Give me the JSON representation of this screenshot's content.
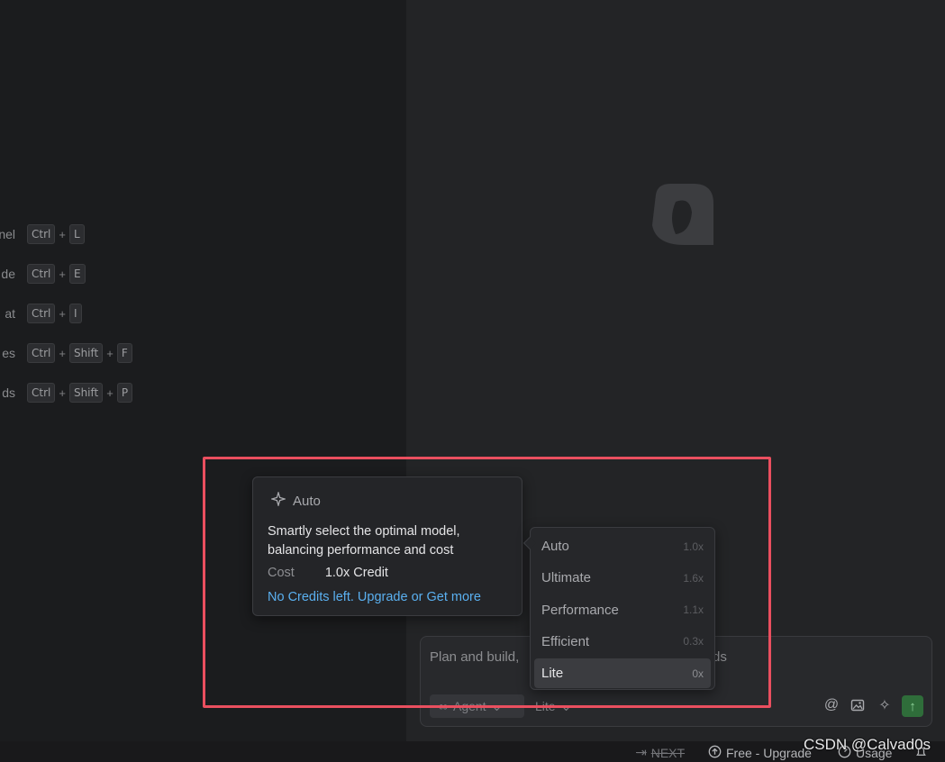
{
  "shortcuts": [
    {
      "label": "nel",
      "keys": [
        "Ctrl",
        "L"
      ]
    },
    {
      "label": "de",
      "keys": [
        "Ctrl",
        "E"
      ]
    },
    {
      "label": "at",
      "keys": [
        "Ctrl",
        "I"
      ]
    },
    {
      "label": "es",
      "keys": [
        "Ctrl",
        "Shift",
        "F"
      ]
    },
    {
      "label": "ds",
      "keys": [
        "Ctrl",
        "Shift",
        "P"
      ]
    }
  ],
  "shortcut_plus": "+",
  "tooltip": {
    "icon": "sparkle-icon",
    "title": "Auto",
    "description": "Smartly select the optimal model, balancing performance and cost",
    "cost_label": "Cost",
    "cost_value": "1.0x Credit",
    "link": "No Credits left. Upgrade or Get more"
  },
  "model_menu": {
    "items": [
      {
        "label": "Auto",
        "multiplier": "1.0x",
        "selected": false
      },
      {
        "label": "Ultimate",
        "multiplier": "1.6x",
        "selected": false
      },
      {
        "label": "Performance",
        "multiplier": "1.1x",
        "selected": false
      },
      {
        "label": "Efficient",
        "multiplier": "0.3x",
        "selected": false
      },
      {
        "label": "Lite",
        "multiplier": "0x",
        "selected": true
      }
    ]
  },
  "composer": {
    "placeholder": "Plan and build,",
    "placeholder_tail": "ds",
    "agent_label": "Agent",
    "agent_icon": "infinity-icon",
    "model_label": "Lite",
    "tools": [
      "at-icon",
      "image-icon",
      "sparkle-icon"
    ],
    "send_icon": "arrow-up-icon"
  },
  "status_bar": {
    "next": "NEXT",
    "plan": "Free - Upgrade",
    "usage": "Usage",
    "bell_icon": "bell-icon"
  },
  "watermark": "CSDN @Calvad0s",
  "colors": {
    "accent_link": "#5ab0f0",
    "send_button": "#2f6d3a",
    "highlight_frame": "#ea4f5f"
  }
}
